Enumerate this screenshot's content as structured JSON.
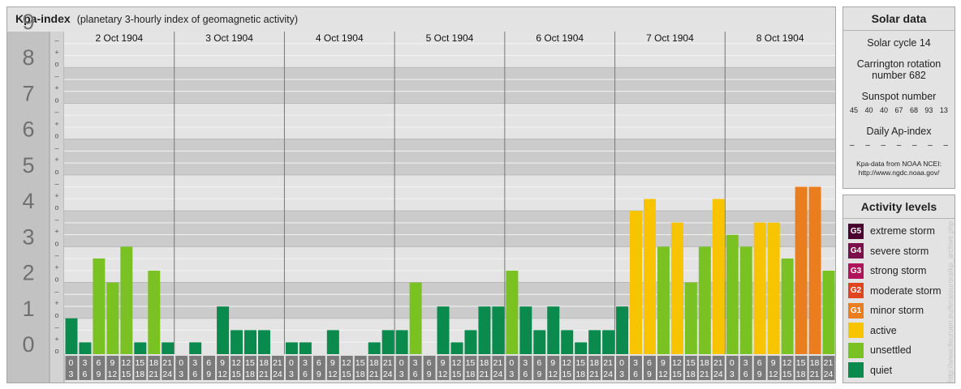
{
  "title": {
    "main": "Kpa-index",
    "sub": "(planetary 3-hourly index of geomagnetic activity)"
  },
  "colors": {
    "quiet": "#0a8a4c",
    "unsettled": "#7ac124",
    "active": "#f8c400",
    "minor": "#ea7e1f",
    "moderate": "#e0461d",
    "strong": "#b0155b",
    "severe": "#7a0f4a",
    "extreme": "#4a0130"
  },
  "chart_data": {
    "type": "bar",
    "title": "Kpa-index",
    "subtitle": "(planetary 3-hourly index of geomagnetic activity)",
    "ylim": [
      0,
      9
    ],
    "y_tick_labels": [
      "0",
      "1",
      "2",
      "3",
      "4",
      "5",
      "6",
      "7",
      "8",
      "9"
    ],
    "sub_tick_labels": [
      "o",
      "+",
      "–"
    ],
    "days": [
      "2 Oct 1904",
      "3 Oct 1904",
      "4 Oct 1904",
      "5 Oct 1904",
      "6 Oct 1904",
      "7 Oct 1904",
      "8 Oct 1904"
    ],
    "interval_start_labels": [
      "0",
      "3",
      "6",
      "9",
      "12",
      "15",
      "18",
      "21"
    ],
    "interval_end_labels": [
      "3",
      "6",
      "9",
      "12",
      "15",
      "18",
      "21",
      "24"
    ],
    "values": [
      [
        1.0,
        0.33,
        2.67,
        2.0,
        3.0,
        0.33,
        2.33,
        0.33
      ],
      [
        0.0,
        0.33,
        0.0,
        1.33,
        0.67,
        0.67,
        0.67,
        0.0
      ],
      [
        0.33,
        0.33,
        0.0,
        0.67,
        0.0,
        0.0,
        0.33,
        0.67
      ],
      [
        0.67,
        2.0,
        0.0,
        1.33,
        0.33,
        0.67,
        1.33,
        1.33
      ],
      [
        2.33,
        1.33,
        0.67,
        1.33,
        0.67,
        0.33,
        0.67,
        0.67
      ],
      [
        1.33,
        4.0,
        4.33,
        3.0,
        3.67,
        2.0,
        3.0,
        4.33
      ],
      [
        3.33,
        3.0,
        3.67,
        3.67,
        2.67,
        4.67,
        4.67,
        2.33
      ]
    ]
  },
  "solar": {
    "title": "Solar data",
    "cycle": "Solar cycle 14",
    "carrington_line1": "Carrington rotation",
    "carrington_line2": "number 682",
    "sunspot_label": "Sunspot number",
    "sunspot_values": [
      "45",
      "40",
      "40",
      "67",
      "68",
      "93",
      "13"
    ],
    "ap_label": "Daily Ap-index",
    "ap_values": [
      "–",
      "–",
      "–",
      "–",
      "–",
      "–",
      "–"
    ],
    "credit_line1": "Kpa-data from NOAA NCEI:",
    "credit_line2": "http://www.ngdc.noaa.gov/"
  },
  "legend": {
    "title": "Activity levels",
    "items": [
      {
        "badge": "G5",
        "label": "extreme storm",
        "color": "#4a0130"
      },
      {
        "badge": "G4",
        "label": "severe storm",
        "color": "#7a0f4a"
      },
      {
        "badge": "G3",
        "label": "strong storm",
        "color": "#b0155b"
      },
      {
        "badge": "G2",
        "label": "moderate storm",
        "color": "#e0461d"
      },
      {
        "badge": "G1",
        "label": "minor storm",
        "color": "#ea7e1f"
      },
      {
        "badge": "",
        "label": "active",
        "color": "#f8c400"
      },
      {
        "badge": "",
        "label": "unsettled",
        "color": "#7ac124"
      },
      {
        "badge": "",
        "label": "quiet",
        "color": "#0a8a4c"
      }
    ]
  },
  "watermark": "http://www.fleuruen.eu/fera/aurora/kp_archive.php"
}
